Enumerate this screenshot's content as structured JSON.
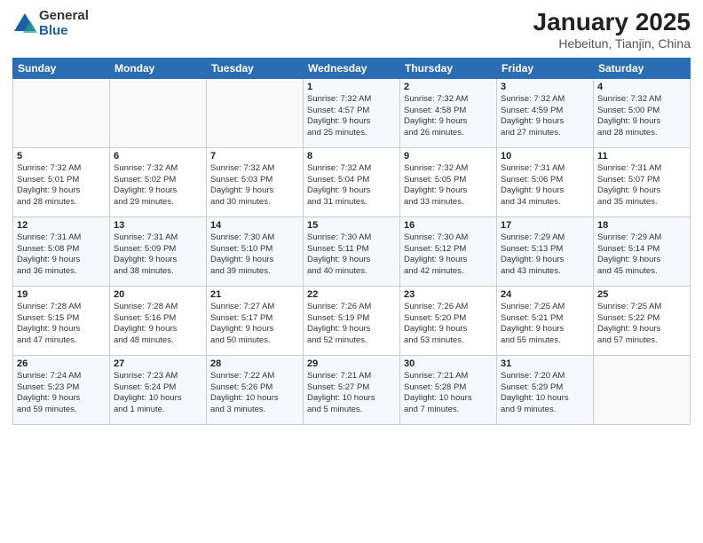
{
  "header": {
    "logo_general": "General",
    "logo_blue": "Blue",
    "month_year": "January 2025",
    "location": "Hebeitun, Tianjin, China"
  },
  "weekdays": [
    "Sunday",
    "Monday",
    "Tuesday",
    "Wednesday",
    "Thursday",
    "Friday",
    "Saturday"
  ],
  "weeks": [
    [
      {
        "day": "",
        "content": ""
      },
      {
        "day": "",
        "content": ""
      },
      {
        "day": "",
        "content": ""
      },
      {
        "day": "1",
        "content": "Sunrise: 7:32 AM\nSunset: 4:57 PM\nDaylight: 9 hours\nand 25 minutes."
      },
      {
        "day": "2",
        "content": "Sunrise: 7:32 AM\nSunset: 4:58 PM\nDaylight: 9 hours\nand 26 minutes."
      },
      {
        "day": "3",
        "content": "Sunrise: 7:32 AM\nSunset: 4:59 PM\nDaylight: 9 hours\nand 27 minutes."
      },
      {
        "day": "4",
        "content": "Sunrise: 7:32 AM\nSunset: 5:00 PM\nDaylight: 9 hours\nand 28 minutes."
      }
    ],
    [
      {
        "day": "5",
        "content": "Sunrise: 7:32 AM\nSunset: 5:01 PM\nDaylight: 9 hours\nand 28 minutes."
      },
      {
        "day": "6",
        "content": "Sunrise: 7:32 AM\nSunset: 5:02 PM\nDaylight: 9 hours\nand 29 minutes."
      },
      {
        "day": "7",
        "content": "Sunrise: 7:32 AM\nSunset: 5:03 PM\nDaylight: 9 hours\nand 30 minutes."
      },
      {
        "day": "8",
        "content": "Sunrise: 7:32 AM\nSunset: 5:04 PM\nDaylight: 9 hours\nand 31 minutes."
      },
      {
        "day": "9",
        "content": "Sunrise: 7:32 AM\nSunset: 5:05 PM\nDaylight: 9 hours\nand 33 minutes."
      },
      {
        "day": "10",
        "content": "Sunrise: 7:31 AM\nSunset: 5:06 PM\nDaylight: 9 hours\nand 34 minutes."
      },
      {
        "day": "11",
        "content": "Sunrise: 7:31 AM\nSunset: 5:07 PM\nDaylight: 9 hours\nand 35 minutes."
      }
    ],
    [
      {
        "day": "12",
        "content": "Sunrise: 7:31 AM\nSunset: 5:08 PM\nDaylight: 9 hours\nand 36 minutes."
      },
      {
        "day": "13",
        "content": "Sunrise: 7:31 AM\nSunset: 5:09 PM\nDaylight: 9 hours\nand 38 minutes."
      },
      {
        "day": "14",
        "content": "Sunrise: 7:30 AM\nSunset: 5:10 PM\nDaylight: 9 hours\nand 39 minutes."
      },
      {
        "day": "15",
        "content": "Sunrise: 7:30 AM\nSunset: 5:11 PM\nDaylight: 9 hours\nand 40 minutes."
      },
      {
        "day": "16",
        "content": "Sunrise: 7:30 AM\nSunset: 5:12 PM\nDaylight: 9 hours\nand 42 minutes."
      },
      {
        "day": "17",
        "content": "Sunrise: 7:29 AM\nSunset: 5:13 PM\nDaylight: 9 hours\nand 43 minutes."
      },
      {
        "day": "18",
        "content": "Sunrise: 7:29 AM\nSunset: 5:14 PM\nDaylight: 9 hours\nand 45 minutes."
      }
    ],
    [
      {
        "day": "19",
        "content": "Sunrise: 7:28 AM\nSunset: 5:15 PM\nDaylight: 9 hours\nand 47 minutes."
      },
      {
        "day": "20",
        "content": "Sunrise: 7:28 AM\nSunset: 5:16 PM\nDaylight: 9 hours\nand 48 minutes."
      },
      {
        "day": "21",
        "content": "Sunrise: 7:27 AM\nSunset: 5:17 PM\nDaylight: 9 hours\nand 50 minutes."
      },
      {
        "day": "22",
        "content": "Sunrise: 7:26 AM\nSunset: 5:19 PM\nDaylight: 9 hours\nand 52 minutes."
      },
      {
        "day": "23",
        "content": "Sunrise: 7:26 AM\nSunset: 5:20 PM\nDaylight: 9 hours\nand 53 minutes."
      },
      {
        "day": "24",
        "content": "Sunrise: 7:25 AM\nSunset: 5:21 PM\nDaylight: 9 hours\nand 55 minutes."
      },
      {
        "day": "25",
        "content": "Sunrise: 7:25 AM\nSunset: 5:22 PM\nDaylight: 9 hours\nand 57 minutes."
      }
    ],
    [
      {
        "day": "26",
        "content": "Sunrise: 7:24 AM\nSunset: 5:23 PM\nDaylight: 9 hours\nand 59 minutes."
      },
      {
        "day": "27",
        "content": "Sunrise: 7:23 AM\nSunset: 5:24 PM\nDaylight: 10 hours\nand 1 minute."
      },
      {
        "day": "28",
        "content": "Sunrise: 7:22 AM\nSunset: 5:26 PM\nDaylight: 10 hours\nand 3 minutes."
      },
      {
        "day": "29",
        "content": "Sunrise: 7:21 AM\nSunset: 5:27 PM\nDaylight: 10 hours\nand 5 minutes."
      },
      {
        "day": "30",
        "content": "Sunrise: 7:21 AM\nSunset: 5:28 PM\nDaylight: 10 hours\nand 7 minutes."
      },
      {
        "day": "31",
        "content": "Sunrise: 7:20 AM\nSunset: 5:29 PM\nDaylight: 10 hours\nand 9 minutes."
      },
      {
        "day": "",
        "content": ""
      }
    ]
  ]
}
